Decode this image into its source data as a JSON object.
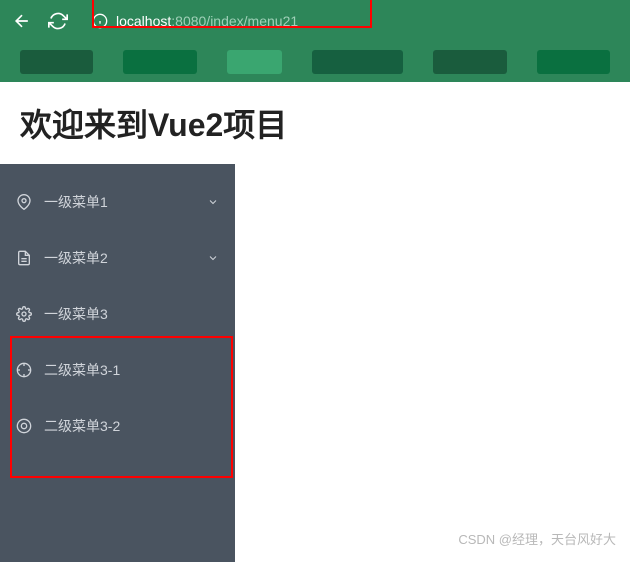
{
  "url": {
    "host": "localhost",
    "path": ":8080/index/menu21"
  },
  "page": {
    "title": "欢迎来到Vue2项目"
  },
  "menu": {
    "items": [
      {
        "label": "一级菜单1",
        "icon": "location",
        "hasChevron": true
      },
      {
        "label": "一级菜单2",
        "icon": "document",
        "hasChevron": true
      },
      {
        "label": "一级菜单3",
        "icon": "gear",
        "hasChevron": false
      },
      {
        "label": "二级菜单3-1",
        "icon": "target",
        "hasChevron": false
      },
      {
        "label": "二级菜单3-2",
        "icon": "circle",
        "hasChevron": false
      }
    ]
  },
  "watermark": "CSDN @经理，天台风好大"
}
